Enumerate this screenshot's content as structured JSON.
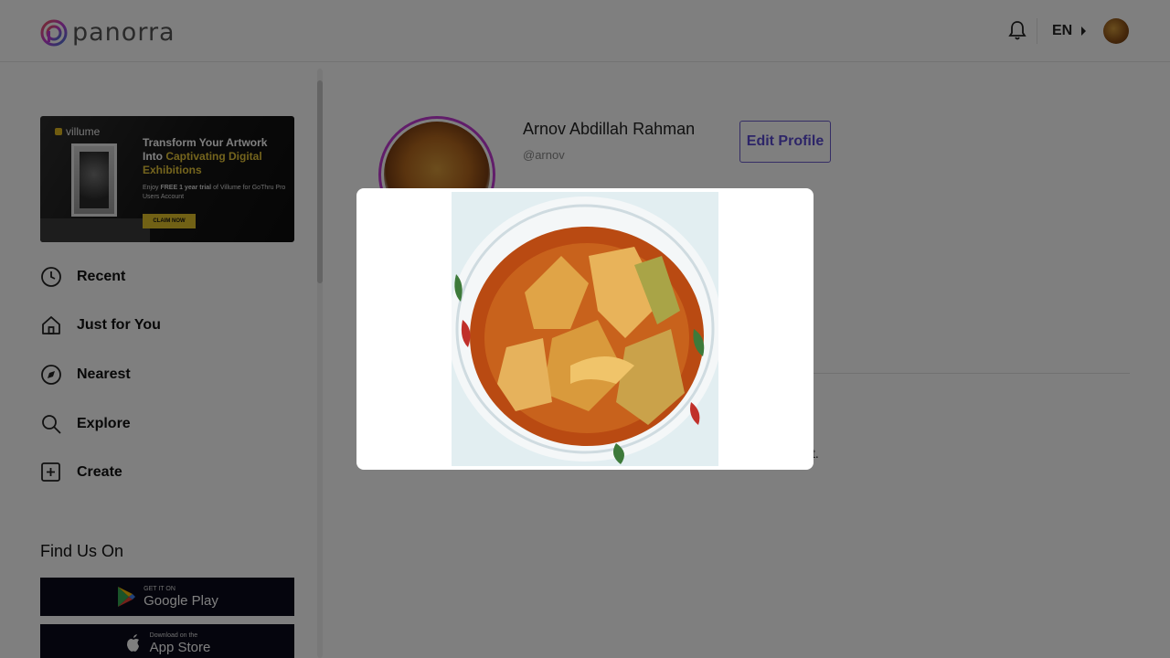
{
  "header": {
    "logo_text": "panorra",
    "language": "EN"
  },
  "sidebar": {
    "banner": {
      "brand": "villume",
      "headline_1": "Transform Your Artwork Into",
      "headline_2": "Captivating Digital Exhibitions",
      "sub_1": "Enjoy",
      "sub_bold": "FREE 1 year trial",
      "sub_2": "of Villume for GoThru Pro Users Account",
      "cta": "CLAIM NOW"
    },
    "nav": [
      {
        "label": "Recent",
        "icon": "clock-icon"
      },
      {
        "label": "Just for You",
        "icon": "home-icon"
      },
      {
        "label": "Nearest",
        "icon": "compass-icon"
      },
      {
        "label": "Explore",
        "icon": "search-icon"
      },
      {
        "label": "Create",
        "icon": "plus-square-icon"
      }
    ],
    "find_us": "Find Us On",
    "google_play": {
      "small": "GET IT ON",
      "big": "Google Play"
    },
    "app_store": {
      "small": "Download on the",
      "big": "App Store"
    }
  },
  "profile": {
    "name": "Arnov Abdillah Rahman",
    "handle": "@arnov",
    "edit_label": "Edit Profile",
    "partial_text": "t."
  },
  "colors": {
    "accent": "#5a4bd0",
    "avatar_ring": "#c23bd4",
    "overlay": "rgba(0,0,0,0.5)"
  }
}
